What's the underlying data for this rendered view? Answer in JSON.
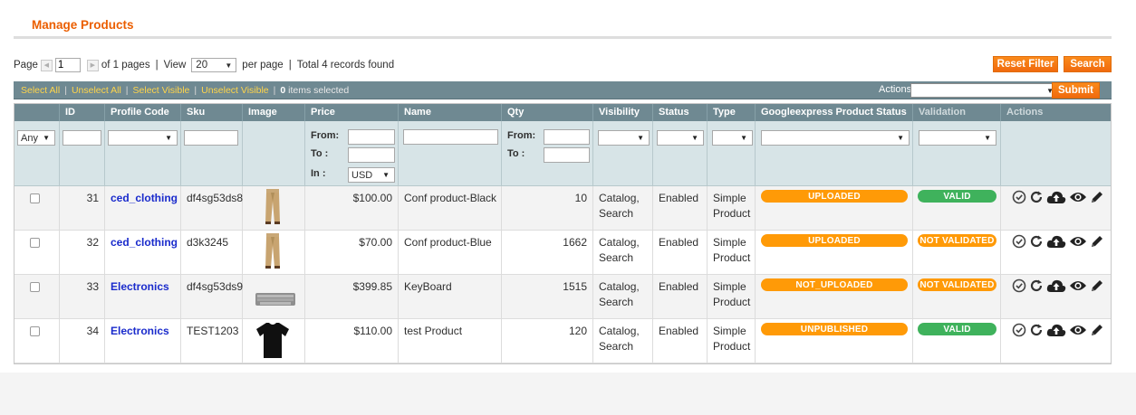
{
  "page": {
    "title": "Manage Products"
  },
  "pager": {
    "page_label": "Page",
    "page_value": "1",
    "of_pages": "of 1 pages",
    "separator": "|",
    "view_label": "View",
    "per_page_value": "20",
    "per_page_label": "per page",
    "total_records": "Total 4 records found"
  },
  "buttons": {
    "reset_filter": "Reset Filter",
    "search": "Search",
    "submit": "Submit"
  },
  "massaction": {
    "select_all": "Select All",
    "unselect_all": "Unselect All",
    "select_visible": "Select Visible",
    "unselect_visible": "Unselect Visible",
    "selected_count": "0",
    "selected_suffix": "items selected",
    "actions_label": "Actions",
    "actions_value": ""
  },
  "columns": {
    "id": "ID",
    "profile_code": "Profile Code",
    "sku": "Sku",
    "image": "Image",
    "price": "Price",
    "name": "Name",
    "qty": "Qty",
    "visibility": "Visibility",
    "status": "Status",
    "type": "Type",
    "gx_status": "Googleexpress Product Status",
    "validation": "Validation",
    "actions": "Actions"
  },
  "filters": {
    "massaction_value": "Any",
    "price_from_label": "From:",
    "price_to_label": "To :",
    "price_in_label": "In :",
    "currency_value": "USD",
    "qty_from_label": "From:",
    "qty_to_label": "To :"
  },
  "rows": [
    {
      "id": "31",
      "profile_code": "ced_clothing",
      "sku": "df4sg53ds8",
      "image": "khaki-pants",
      "price": "$100.00",
      "name": "Conf product-Black",
      "qty": "10",
      "visibility_1": "Catalog,",
      "visibility_2": "Search",
      "status": "Enabled",
      "type_1": "Simple",
      "type_2": "Product",
      "gx_status": "UPLOADED",
      "gx_color": "#ff9a07",
      "validation": "VALID",
      "validation_color": "#3fb25c"
    },
    {
      "id": "32",
      "profile_code": "ced_clothing",
      "sku": "d3k3245",
      "image": "khaki-pants",
      "price": "$70.00",
      "name": "Conf product-Blue",
      "qty": "1662",
      "visibility_1": "Catalog,",
      "visibility_2": "Search",
      "status": "Enabled",
      "type_1": "Simple",
      "type_2": "Product",
      "gx_status": "UPLOADED",
      "gx_color": "#ff9a07",
      "validation": "NOT VALIDATED",
      "validation_color": "#ff9a07"
    },
    {
      "id": "33",
      "profile_code": "Electronics",
      "sku": "df4sg53ds9",
      "image": "keyboard",
      "price": "$399.85",
      "name": "KeyBoard",
      "qty": "1515",
      "visibility_1": "Catalog,",
      "visibility_2": "Search",
      "status": "Enabled",
      "type_1": "Simple",
      "type_2": "Product",
      "gx_status": "NOT_UPLOADED",
      "gx_color": "#ff9a07",
      "validation": "NOT VALIDATED",
      "validation_color": "#ff9a07"
    },
    {
      "id": "34",
      "profile_code": "Electronics",
      "sku": "TEST1203",
      "image": "black-tshirt",
      "price": "$110.00",
      "name": "test Product",
      "qty": "120",
      "visibility_1": "Catalog,",
      "visibility_2": "Search",
      "status": "Enabled",
      "type_1": "Simple",
      "type_2": "Product",
      "gx_status": "UNPUBLISHED",
      "gx_color": "#ff9a07",
      "validation": "VALID",
      "validation_color": "#3fb25c"
    }
  ],
  "action_icons": [
    "validate-check-icon",
    "sync-refresh-icon",
    "upload-cloud-icon",
    "view-eye-icon",
    "edit-pencil-icon"
  ],
  "colors": {
    "accent_orange": "#eb5e00",
    "header_bg": "#6f8992",
    "filter_bg": "#d7e4e7",
    "link_blue": "#1a2bcc"
  }
}
